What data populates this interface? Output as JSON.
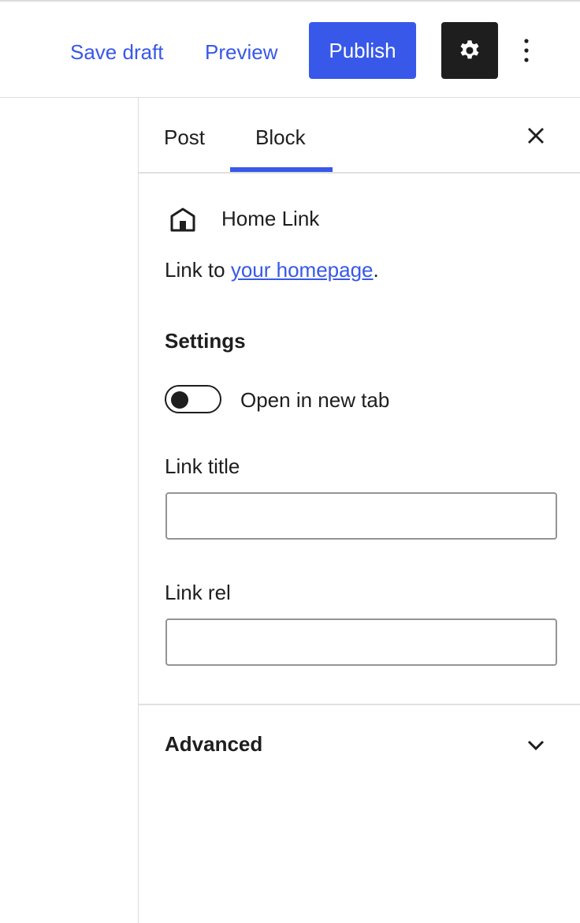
{
  "toolbar": {
    "save_draft_label": "Save draft",
    "preview_label": "Preview",
    "publish_label": "Publish",
    "settings_icon": "gear-icon",
    "more_icon": "vertical-ellipsis-icon"
  },
  "sidebar": {
    "tabs": [
      {
        "label": "Post",
        "active": false
      },
      {
        "label": "Block",
        "active": true
      }
    ],
    "close_icon": "close-icon",
    "block": {
      "icon": "home-icon",
      "title": "Home Link",
      "description_prefix": "Link to ",
      "description_link": "your homepage",
      "description_suffix": "."
    },
    "settings": {
      "heading": "Settings",
      "open_new_tab": {
        "label": "Open in new tab",
        "checked": false
      },
      "link_title": {
        "label": "Link title",
        "value": ""
      },
      "link_rel": {
        "label": "Link rel",
        "value": ""
      }
    },
    "advanced": {
      "label": "Advanced",
      "expanded": false,
      "icon": "chevron-down-icon"
    }
  },
  "colors": {
    "accent": "#3858e9",
    "text": "#1e1e1e",
    "border": "#dcdcde"
  }
}
